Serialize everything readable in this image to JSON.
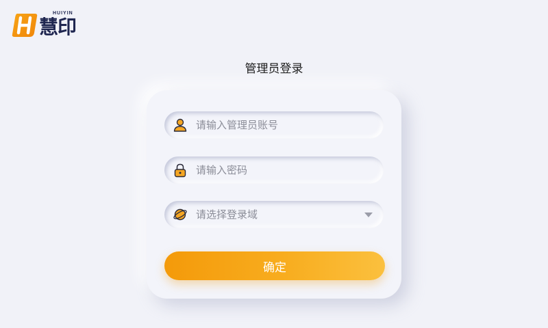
{
  "logo": {
    "en": "HUIYIN",
    "cn": "慧印"
  },
  "page": {
    "title": "管理员登录"
  },
  "form": {
    "account": {
      "placeholder": "请输入管理员账号",
      "value": "",
      "icon": "user-icon"
    },
    "password": {
      "placeholder": "请输入密码",
      "value": "",
      "icon": "lock-icon"
    },
    "domain": {
      "placeholder": "请选择登录域",
      "icon": "globe-icon"
    },
    "submit_label": "确定"
  },
  "colors": {
    "background": "#f1f2f8",
    "accent": "#f49a0a",
    "accent_light": "#fbc03e",
    "brand_dark": "#1f2650"
  }
}
